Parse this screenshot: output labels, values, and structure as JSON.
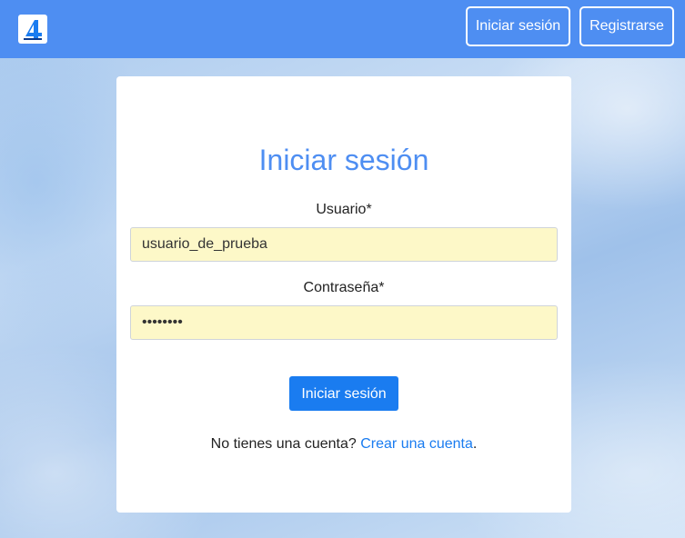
{
  "navbar": {
    "logo_icon": "app-logo-icon",
    "login_label": "Iniciar sesión",
    "register_label": "Registrarse"
  },
  "login_form": {
    "title": "Iniciar sesión",
    "username_label": "Usuario*",
    "username_value": "usuario_de_prueba",
    "password_label": "Contraseña*",
    "password_masked": "••••••••",
    "submit_label": "Iniciar sesión",
    "signup_prompt": "No tienes una cuenta? ",
    "signup_link": "Crear una cuenta",
    "signup_suffix": "."
  },
  "colors": {
    "navbar": "#4e8ef2",
    "accent": "#1a7cf0",
    "title": "#4e8ef2",
    "autofill": "#fdf8c8"
  }
}
